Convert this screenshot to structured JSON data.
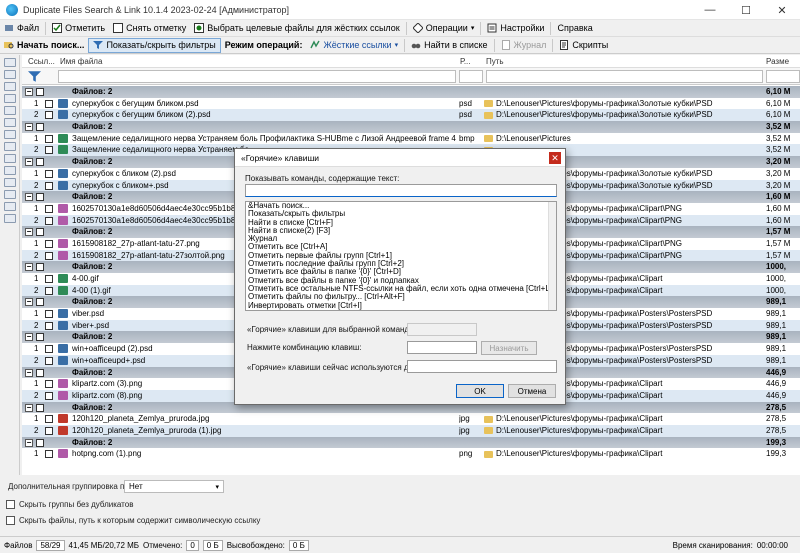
{
  "window": {
    "title": "Duplicate Files Search & Link 10.1.4 2023-02-24 [Администратор]"
  },
  "menu": {
    "file": "Файл",
    "mark": "Отметить",
    "unmark": "Снять отметку",
    "select_target": "Выбрать целевые файлы для жёстких ссылок",
    "operations": "Операции",
    "settings": "Настройки",
    "help": "Справка"
  },
  "toolbar": {
    "start_search": "Начать поиск...",
    "toggle_filters": "Показать/скрыть фильтры",
    "operation_mode_label": "Режим операций:",
    "operation_mode_value": "Жёсткие ссылки",
    "find_in_list": "Найти в списке",
    "journal": "Журнал",
    "scripts": "Скрипты"
  },
  "columns": {
    "links": "Ссыл...",
    "filename": "Имя файла",
    "ext": "Р...",
    "path": "Путь",
    "size": "Разме"
  },
  "rows": [
    {
      "type": "group",
      "name": "Файлов: 2",
      "size": "6,10 М"
    },
    {
      "type": "file",
      "idx": "1",
      "name": "суперкубок с бегущим бликом.psd",
      "ext": "psd",
      "path": "D:\\Lenouser\\Pictures\\форумы-графика\\Золотые кубки\\PSD",
      "size": "6,10 М",
      "icon": "#3a6ea5"
    },
    {
      "type": "file",
      "idx": "2",
      "name": "суперкубок с бегущим бликом (2).psd",
      "ext": "psd",
      "path": "D:\\Lenouser\\Pictures\\форумы-графика\\Золотые кубки\\PSD",
      "size": "6,10 М",
      "icon": "#3a6ea5"
    },
    {
      "type": "group",
      "name": "Файлов: 2",
      "size": "3,52 М"
    },
    {
      "type": "file",
      "idx": "1",
      "name": "Защемление седалищного нерва  Устраняем боль Профилактика  S-HUBme с Лизой Андреевой frame 43).bmp",
      "ext": "bmp",
      "path": "D:\\Lenouser\\Pictures",
      "size": "3,52 М",
      "icon": "#2e8b57"
    },
    {
      "type": "file",
      "idx": "2",
      "name": "Защемление седалищного нерва  Устраняем бо",
      "ext": "",
      "path": "",
      "size": "3,52 М",
      "icon": "#2e8b57"
    },
    {
      "type": "group",
      "name": "Файлов: 2",
      "size": "3,20 М"
    },
    {
      "type": "file",
      "idx": "1",
      "name": "суперкубок с бликом (2).psd",
      "ext": "",
      "path": "",
      "size": "3,20 М",
      "icon": "#3a6ea5"
    },
    {
      "type": "file",
      "idx": "2",
      "name": "суперкубок с бликом+.psd",
      "ext": "",
      "path": "",
      "size": "3,20 М",
      "icon": "#3a6ea5"
    },
    {
      "type": "group",
      "name": "Файлов: 2",
      "size": "1,60 М"
    },
    {
      "type": "file",
      "idx": "1",
      "name": "1602570130a1e8d60506d4aec4e30cc95b1b8ea635",
      "ext": "",
      "path": "",
      "size": "1,60 М",
      "icon": "#b05aa8"
    },
    {
      "type": "file",
      "idx": "2",
      "name": "1602570130a1e8d60506d4aec4e30cc95b1b8ea635",
      "ext": "",
      "path": "",
      "size": "1,60 М",
      "icon": "#b05aa8"
    },
    {
      "type": "group",
      "name": "Файлов: 2",
      "size": "1,57 М"
    },
    {
      "type": "file",
      "idx": "1",
      "name": "1615908182_27p-atlant-tatu-27.png",
      "ext": "",
      "path": "",
      "size": "1,57 М",
      "icon": "#b05aa8"
    },
    {
      "type": "file",
      "idx": "2",
      "name": "1615908182_27p-atlant-tatu-27золтой.png",
      "ext": "",
      "path": "",
      "size": "1,57 М",
      "icon": "#b05aa8"
    },
    {
      "type": "group",
      "name": "Файлов: 2",
      "size": "1000,"
    },
    {
      "type": "file",
      "idx": "1",
      "name": "4-00.gif",
      "ext": "",
      "path": "",
      "size": "1000,",
      "icon": "#2e8b57"
    },
    {
      "type": "file",
      "idx": "2",
      "name": "4-00 (1).gif",
      "ext": "",
      "path": "",
      "size": "1000,",
      "icon": "#2e8b57"
    },
    {
      "type": "group",
      "name": "Файлов: 2",
      "size": "989,1"
    },
    {
      "type": "file",
      "idx": "1",
      "name": "viber.psd",
      "ext": "",
      "path": "",
      "size": "989,1",
      "icon": "#3a6ea5"
    },
    {
      "type": "file",
      "idx": "2",
      "name": "viber+.psd",
      "ext": "",
      "path": "",
      "size": "989,1",
      "icon": "#3a6ea5"
    },
    {
      "type": "group",
      "name": "Файлов: 2",
      "size": "989,1"
    },
    {
      "type": "file",
      "idx": "1",
      "name": "win+oafficeupd (2).psd",
      "ext": "",
      "path": "",
      "size": "989,1",
      "icon": "#3a6ea5"
    },
    {
      "type": "file",
      "idx": "2",
      "name": "win+oafficeupd+.psd",
      "ext": "",
      "path": "",
      "size": "989,1",
      "icon": "#3a6ea5"
    },
    {
      "type": "group",
      "name": "Файлов: 2",
      "size": "446,9"
    },
    {
      "type": "file",
      "idx": "1",
      "name": "klipartz.com (3).png",
      "ext": "",
      "path": "",
      "size": "446,9",
      "icon": "#b05aa8"
    },
    {
      "type": "file",
      "idx": "2",
      "name": "klipartz.com (8).png",
      "ext": "",
      "path": "",
      "size": "446,9",
      "icon": "#b05aa8"
    },
    {
      "type": "group",
      "name": "Файлов: 2",
      "size": "278,5"
    },
    {
      "type": "file",
      "idx": "1",
      "name": "120h120_planeta_Zemlya_pruroda.jpg",
      "ext": "jpg",
      "path": "D:\\Lenouser\\Pictures\\форумы-графика\\Clipart",
      "size": "278,5",
      "icon": "#c0392b"
    },
    {
      "type": "file",
      "idx": "2",
      "name": "120h120_planeta_Zemlya_pruroda (1).jpg",
      "ext": "jpg",
      "path": "D:\\Lenouser\\Pictures\\форумы-графика\\Clipart",
      "size": "278,5",
      "icon": "#c0392b"
    },
    {
      "type": "group",
      "name": "Файлов: 2",
      "size": "199,3"
    },
    {
      "type": "file",
      "idx": "1",
      "name": "hotpng.com (1).png",
      "ext": "png",
      "path": "D:\\Lenouser\\Pictures\\форумы-графика\\Clipart",
      "size": "199,3",
      "icon": "#b05aa8"
    }
  ],
  "partial_paths": [
    {
      "row": 7,
      "path": "D:\\Lenouser\\Pictures\\форумы-графика\\Золотые кубки\\PSD"
    },
    {
      "row": 8,
      "path": "D:\\Lenouser\\Pictures\\форумы-графика\\Золотые кубки\\PSD"
    },
    {
      "row": 10,
      "path": "D:\\Lenouser\\Pictures\\форумы-графика\\Clipart\\PNG"
    },
    {
      "row": 11,
      "path": "D:\\Lenouser\\Pictures\\форумы-графика\\Clipart\\PNG"
    },
    {
      "row": 13,
      "path": "D:\\Lenouser\\Pictures\\форумы-графика\\Clipart\\PNG"
    },
    {
      "row": 14,
      "path": "D:\\Lenouser\\Pictures\\форумы-графика\\Clipart\\PNG"
    },
    {
      "row": 16,
      "path": "D:\\Lenouser\\Pictures\\форумы-графика\\Clipart"
    },
    {
      "row": 17,
      "path": "D:\\Lenouser\\Pictures\\форумы-графика\\Clipart"
    },
    {
      "row": 19,
      "path": "D:\\Lenouser\\Pictures\\форумы-графика\\Posters\\PostersPSD"
    },
    {
      "row": 20,
      "path": "D:\\Lenouser\\Pictures\\форумы-графика\\Posters\\PostersPSD"
    },
    {
      "row": 22,
      "path": "D:\\Lenouser\\Pictures\\форумы-графика\\Posters\\PostersPSD"
    },
    {
      "row": 23,
      "path": "D:\\Lenouser\\Pictures\\форумы-графика\\Posters\\PostersPSD"
    },
    {
      "row": 25,
      "path": "D:\\Lenouser\\Pictures\\форумы-графика\\Clipart"
    },
    {
      "row": 26,
      "path": "D:\\Lenouser\\Pictures\\форумы-графика\\Clipart"
    }
  ],
  "bottom": {
    "grouping_label": "Дополнительная группировка по",
    "grouping_value": "Нет",
    "hide_groups": "Скрыть группы без дубликатов",
    "hide_symlinks": "Скрыть файлы, путь к которым содержит символическую ссылку"
  },
  "status": {
    "files_label": "Файлов",
    "files_value": "58/29",
    "size_value": "41,45 МБ/20,72 МБ",
    "marked_label": "Отмечено:",
    "marked_value": "0",
    "marked_size": "0 Б",
    "freed_label": "Высвобождено:",
    "freed_value": "0 Б",
    "scan_time_label": "Время сканирования:",
    "scan_time_value": "00:00:00"
  },
  "dialog": {
    "title": "«Горячие» клавиши",
    "filter_label": "Показывать команды, содержащие текст:",
    "filter_value": "",
    "commands": [
      "&Начать поиск...",
      "Показать/скрыть фильтры",
      "Найти в списке [Ctrl+F]",
      "Найти в списке(2) [F3]",
      "Журнал",
      "Отметить все [Ctrl+A]",
      "Отметить первые файлы групп [Ctrl+1]",
      "Отметить последние файлы групп [Ctrl+2]",
      "Отметить все файлы в папке '{0}' [Ctrl+D]",
      "Отметить все файлы в папке '{0}' и подпапках",
      "Отметить все остальные NTFS-ссылки на файл, если хоть одна отмечена [Ctrl+L]",
      "Отметить файлы по фильтру... [Ctrl+Alt+F]",
      "Инвертировать отметки [Ctrl+I]"
    ],
    "hotkeys_for_command": "«Горячие» клавиши для выбранной команды:",
    "press_combo": "Нажмите комбинацию клавиш:",
    "assign": "Назначить",
    "already_used": "«Горячие» клавиши сейчас используются для:",
    "ok": "OK",
    "cancel": "Отмена"
  },
  "colors": {
    "accent": "#0a64c8",
    "group_row": "#b3bcc7",
    "alt_row": "#dde8f3",
    "close": "#c42b1c"
  }
}
